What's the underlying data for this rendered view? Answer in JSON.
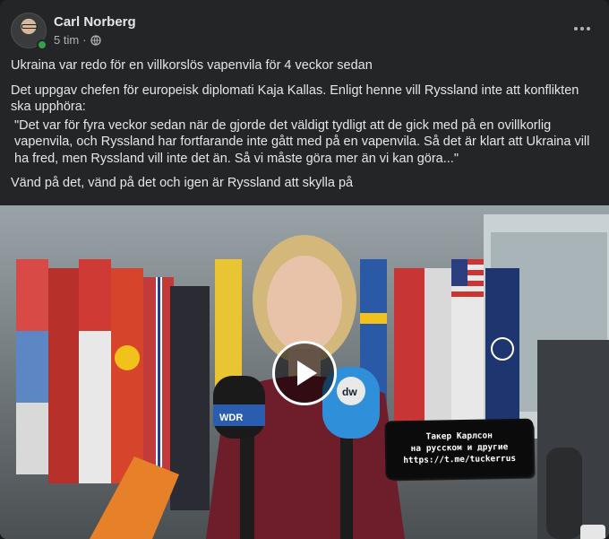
{
  "post": {
    "author": "Carl Norberg",
    "time": "5 tim",
    "separator": "·",
    "audience_icon": "globe-icon",
    "menu_icon": "more-options-icon",
    "paragraphs": [
      "Ukraina var redo för en villkorslös vapenvila för 4 veckor sedan",
      "Det uppgav chefen för europeisk diplomati Kaja Kallas. Enligt henne vill Ryssland inte att konflikten ska upphöra:",
      "\"Det var för fyra veckor sedan när de gjorde det väldigt tydligt att de gick med på en ovillkorlig vapenvila, och Ryssland har fortfarande inte gått med på en vapenvila. Så det är klart att Ukraina vill ha fred, men Ryssland vill inte det än. Så vi måste göra mer än vi kan göra...\"",
      "Vänd på det, vänd på det och igen är Ryssland att skylla på"
    ]
  },
  "video": {
    "play_icon": "play-icon",
    "mic_labels": [
      "WDR",
      "dw"
    ],
    "sticker_lines": [
      "Такер Карлсон",
      "на русском и другие",
      "https://t.me/tuckerrus"
    ]
  },
  "colors": {
    "card_bg": "#242526",
    "text": "#e4e6eb",
    "muted": "#b0b3b8",
    "online": "#31a24c"
  }
}
